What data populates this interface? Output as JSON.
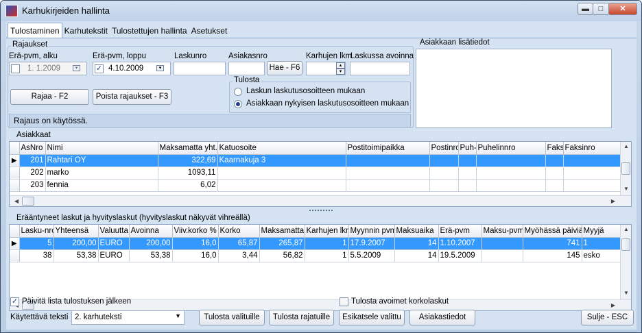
{
  "window": {
    "title": "Karhukirjeiden hallinta",
    "minimize": "▬",
    "maximize": "□",
    "close": "✕"
  },
  "tabs": [
    "Tulostaminen",
    "Karhutekstit",
    "Tulostettujen hallinta",
    "Asetukset"
  ],
  "filters": {
    "group_label": "Rajaukset",
    "date_start_label": "Erä-pvm, alku",
    "date_start_value": "1.  1.2009",
    "date_start_checked": false,
    "date_end_label": "Erä-pvm, loppu",
    "date_end_value": "4.10.2009",
    "date_end_checked": true,
    "invoice_no_label": "Laskunro",
    "invoice_no_value": "",
    "customer_no_label": "Asiakasnro",
    "customer_no_value": "",
    "find_button": "Hae - F6",
    "reminder_count_label": "Karhujen lkm",
    "reminder_count_value": "",
    "open_on_invoice_label": "Laskussa avoinna",
    "open_on_invoice_value": "",
    "filter_button": "Rajaa - F2",
    "remove_filters_button": "Poista rajaukset - F3",
    "print_group_label": "Tulosta",
    "print_option_1": "Laskun laskutusosoitteen mukaan",
    "print_option_2": "Asiakkaan nykyisen laskutusosoitteen mukaan",
    "status_text": "Rajaus on käytössä."
  },
  "customer_info": {
    "label": "Asiakkaan lisätiedot",
    "text": ""
  },
  "customers": {
    "label": "Asiakkaat",
    "columns": [
      "AsNro",
      "Nimi",
      "Maksamatta yht.",
      "Katuosoite",
      "Postitoimipaikka",
      "Postinro",
      "Puh-",
      "Puhelinnro",
      "Faks",
      "Faksinro"
    ],
    "rows": [
      [
        "201",
        "Rahtari OY",
        "322,69",
        "Kaarnakuja 3",
        "",
        "",
        "",
        "",
        "",
        ""
      ],
      [
        "202",
        "marko",
        "1093,11",
        "",
        "",
        "",
        "",
        "",
        "",
        ""
      ],
      [
        "203",
        "fennia",
        "6,02",
        "",
        "",
        "",
        "",
        "",
        "",
        ""
      ]
    ],
    "selected_row": 0
  },
  "invoices": {
    "label": "Erääntyneet laskut ja hyvityslaskut (hyvityslaskut näkyvät vihreällä)",
    "columns": [
      "Lasku-nro",
      "Yhteensä",
      "Valuutta",
      "Avoinna",
      "Viiv.korko %",
      "Korko",
      "Maksamatta",
      "Karhujen lkm",
      "Myynnin pvm",
      "Maksuaika",
      "Erä-pvm",
      "Maksu-pvm",
      "Myöhässä päiviä",
      "Myyjä"
    ],
    "rows": [
      [
        "5",
        "200,00",
        "EURO",
        "200,00",
        "16,0",
        "65,87",
        "265,87",
        "1",
        "17.9.2007",
        "14",
        "1.10.2007",
        "",
        "741",
        "1"
      ],
      [
        "38",
        "53,38",
        "EURO",
        "53,38",
        "16,0",
        "3,44",
        "56,82",
        "1",
        "5.5.2009",
        "14",
        "19.5.2009",
        "",
        "145",
        "esko"
      ]
    ],
    "selected_row": 0
  },
  "footer": {
    "refresh_label": "Päivitä lista tulostuksen jälkeen",
    "refresh_checked": true,
    "print_open_interest_label": "Tulosta avoimet korkolaskut",
    "print_open_interest_checked": false,
    "text_label": "Käytettävä teksti",
    "text_value": "2. karhuteksti",
    "print_selected": "Tulosta valituille",
    "print_filtered": "Tulosta rajatuille",
    "preview_selected": "Esikatsele valittu",
    "customer_details": "Asiakastiedot",
    "close": "Sulje - ESC"
  }
}
